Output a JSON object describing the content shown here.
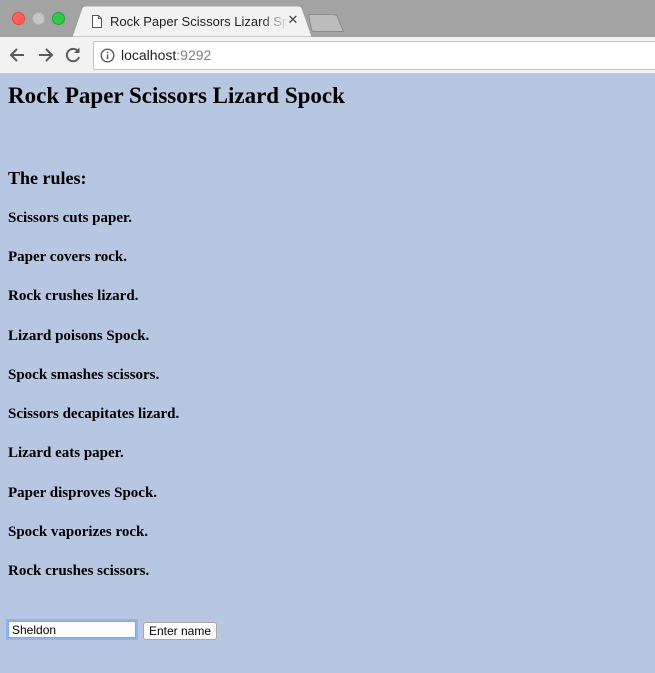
{
  "browser": {
    "tab_title": "Rock Paper Scissors Lizard Spock",
    "address": {
      "host": "localhost",
      "port": ":9292"
    }
  },
  "page": {
    "title": "Rock Paper Scissors Lizard Spock",
    "rules_heading": "The rules:",
    "rules": [
      "Scissors cuts paper.",
      "Paper covers rock.",
      "Rock crushes lizard.",
      "Lizard poisons Spock.",
      "Spock smashes scissors.",
      "Scissors decapitates lizard.",
      "Lizard eats paper.",
      "Paper disproves Spock.",
      "Spock vaporizes rock.",
      "Rock crushes scissors."
    ],
    "form": {
      "name_value": "Sheldon",
      "submit_label": "Enter name"
    }
  },
  "colors": {
    "page_background": "#b7c7e1",
    "focus_ring": "#8db5f2"
  },
  "icons": {
    "close": "close-icon",
    "back": "back-arrow-icon",
    "forward": "forward-arrow-icon",
    "reload": "reload-icon",
    "info": "info-icon",
    "document": "document-icon"
  }
}
